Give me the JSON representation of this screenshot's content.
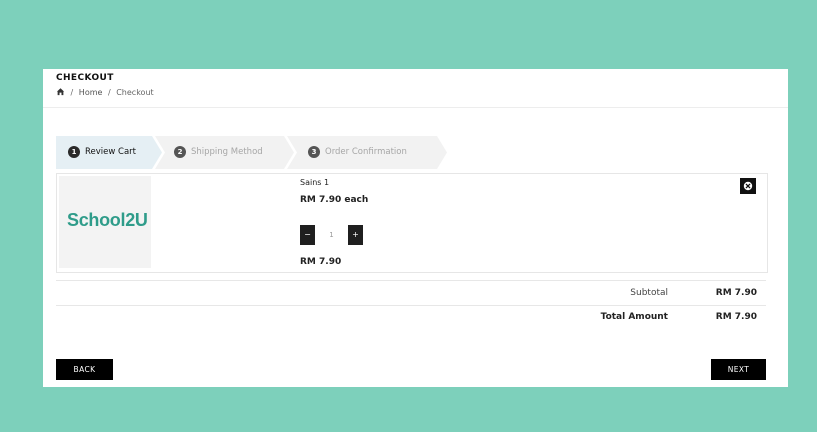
{
  "page": {
    "background_color": "#7dd0bb",
    "card_color": "#ffffff"
  },
  "header": {
    "title": "CHECKOUT",
    "breadcrumb": {
      "home_icon": "home-icon",
      "separator_1": "/",
      "home_label": "Home",
      "separator_2": "/",
      "current_label": "Checkout"
    }
  },
  "steps": [
    {
      "number": "1",
      "label": "Review Cart",
      "state": "active"
    },
    {
      "number": "2",
      "label": "Shipping Method",
      "state": "inactive"
    },
    {
      "number": "3",
      "label": "Order Confirmation",
      "state": "inactive"
    }
  ],
  "cart": {
    "items": [
      {
        "image_logo_text": "School2U",
        "name": "Sains 1",
        "unit_price": "RM 7.90 each",
        "quantity": "1",
        "decrease_label": "−",
        "increase_label": "+",
        "line_total": "RM 7.90",
        "remove_icon": "remove-icon"
      }
    ]
  },
  "summary": {
    "subtotal_label": "Subtotal",
    "subtotal_value": "RM 7.90",
    "total_label": "Total Amount",
    "total_value": "RM 7.90"
  },
  "actions": {
    "back_label": "BACK",
    "next_label": "NEXT"
  }
}
